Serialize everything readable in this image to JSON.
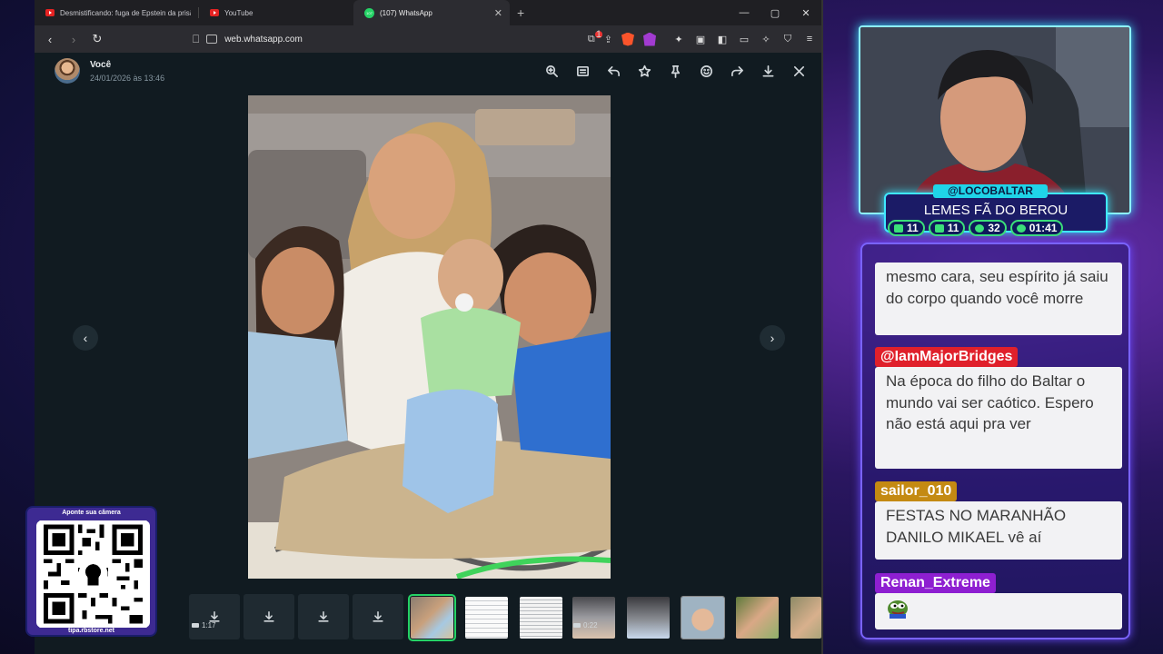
{
  "browser": {
    "tabs": [
      {
        "title": "Desmistificando: fuga de Epstein da prisão c",
        "active": false
      },
      {
        "title": "YouTube",
        "active": false
      },
      {
        "title": "(107) WhatsApp",
        "active": true
      }
    ],
    "address": "web.whatsapp.com",
    "extension_badge": "1"
  },
  "viewer": {
    "sender_name": "Você",
    "sent_at": "24/01/2026 às 13:46",
    "actions": [
      "zoom-in",
      "caption",
      "reply",
      "star",
      "pin",
      "react",
      "forward",
      "download",
      "close"
    ],
    "strip": {
      "video_durations": [
        "1:17",
        "0:22"
      ]
    }
  },
  "overlay": {
    "qr": {
      "title": "Aponte sua câmera",
      "url": "tipa.rbstore.net"
    },
    "streamer": {
      "handle": "@LOCOBALTAR",
      "display_name": "LEMES FÃ DO BEROU",
      "stats": [
        "11",
        "11",
        "32",
        "01:41"
      ]
    },
    "chat": [
      {
        "user": "",
        "text": "mesmo cara, seu espírito já saiu do corpo quando você morre",
        "color": ""
      },
      {
        "user": "@IamMajorBridges",
        "text": "Na época do filho do Baltar o mundo vai ser caótico. Espero não está aqui pra ver",
        "color": "#e0202b"
      },
      {
        "user": "sailor_010",
        "text": "FESTAS NO MARANHÃO DANILO MIKAEL vê aí",
        "color": "#c48a12"
      },
      {
        "user": "Renan_Extreme",
        "text": "",
        "color": "#8e1fd1",
        "emote": "pepe-emote"
      }
    ]
  }
}
